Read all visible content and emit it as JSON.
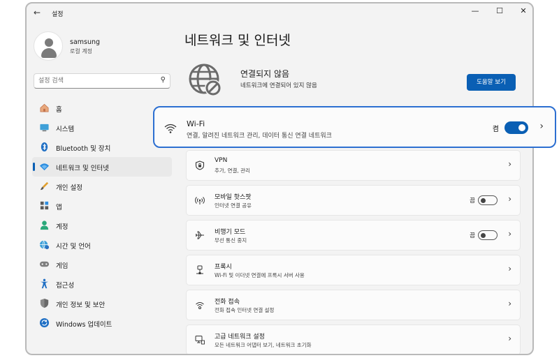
{
  "window": {
    "title": "설정",
    "back_icon": "back-arrow-icon",
    "controls": [
      "minimize-icon",
      "maximize-icon",
      "close-icon"
    ]
  },
  "user": {
    "name": "samsung",
    "account_type": "로컬 계정"
  },
  "search": {
    "placeholder": "설정 검색",
    "value": "설정 검색"
  },
  "sidebar": {
    "items": [
      {
        "label": "홈",
        "icon": "home-icon"
      },
      {
        "label": "시스템",
        "icon": "system-icon"
      },
      {
        "label": "Bluetooth 및 장치",
        "icon": "bluetooth-icon"
      },
      {
        "label": "네트워크 및 인터넷",
        "icon": "network-icon",
        "active": true
      },
      {
        "label": "개인 설정",
        "icon": "brush-icon"
      },
      {
        "label": "앱",
        "icon": "apps-icon"
      },
      {
        "label": "계정",
        "icon": "account-icon"
      },
      {
        "label": "시간 및 언어",
        "icon": "globe-clock-icon"
      },
      {
        "label": "게임",
        "icon": "gamepad-icon"
      },
      {
        "label": "접근성",
        "icon": "accessibility-icon"
      },
      {
        "label": "개인 정보 및 보안",
        "icon": "shield-icon"
      },
      {
        "label": "Windows 업데이트",
        "icon": "update-icon"
      }
    ]
  },
  "main": {
    "title": "네트워크 및 인터넷",
    "status": {
      "title": "연결되지 않음",
      "subtitle": "네트워크에 연결되어 있지 않음",
      "help_button": "도움말 보기"
    },
    "wifi": {
      "title": "Wi-Fi",
      "subtitle": "연결, 알려진 네트워크 관리, 데이터 통신 연결 네트워크",
      "state": "켬",
      "on": true
    },
    "cards": [
      {
        "title": "VPN",
        "subtitle": "추가, 연결, 관리",
        "icon": "vpn-shield-icon"
      },
      {
        "title": "모바일 핫스팟",
        "subtitle": "인터넷 연결 공유",
        "icon": "hotspot-icon",
        "state": "끔"
      },
      {
        "title": "비행기 모드",
        "subtitle": "무선 통신 중지",
        "icon": "airplane-icon",
        "state": "끔"
      },
      {
        "title": "프록시",
        "subtitle": "Wi-Fi 및 이더넷 연결에 프록시 서버 사용",
        "icon": "proxy-icon"
      },
      {
        "title": "전화 접속",
        "subtitle": "전화 접속 인터넷 연결 설정",
        "icon": "dialup-icon"
      },
      {
        "title": "고급 네트워크 설정",
        "subtitle": "모든 네트워크 어댑터 보기, 네트워크 초기화",
        "icon": "advanced-network-icon"
      }
    ]
  },
  "colors": {
    "accent": "#0a5fb4",
    "highlight_border": "#2c6fd1",
    "window_bg": "#f3f3f3"
  }
}
